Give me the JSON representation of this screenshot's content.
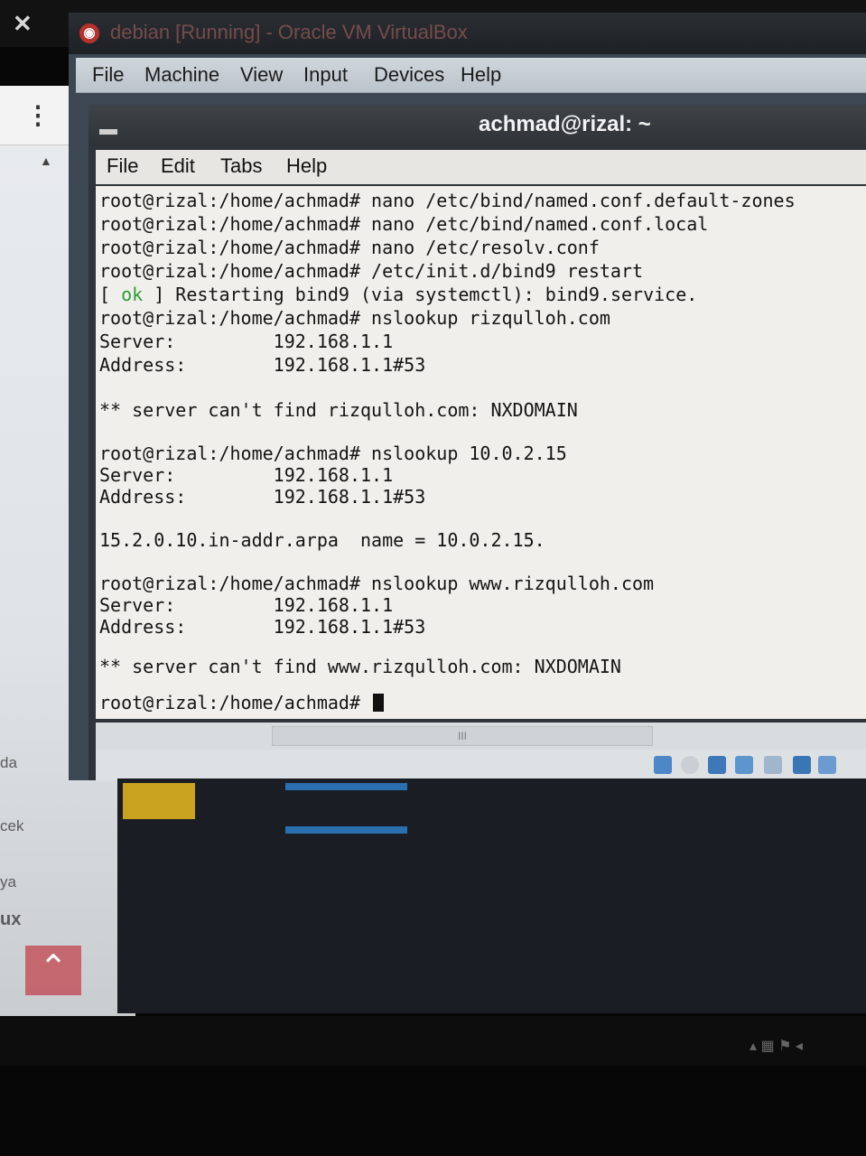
{
  "host": {
    "close_glyph": "✕",
    "kebab_glyph": "⋮",
    "side_words": [
      "da",
      "cek",
      "ya",
      "ux"
    ],
    "up_button_glyph": "⌃"
  },
  "vbox": {
    "title": "debian [Running] - Oracle VM VirtualBox",
    "menu": [
      "File",
      "Machine",
      "View",
      "Input",
      "Devices",
      "Help"
    ]
  },
  "terminal": {
    "title": "achmad@rizal: ~",
    "menu": [
      "File",
      "Edit",
      "Tabs",
      "Help"
    ],
    "lines": [
      "root@rizal:/home/achmad# nano /etc/bind/named.conf.default-zones",
      "root@rizal:/home/achmad# nano /etc/bind/named.conf.local",
      "root@rizal:/home/achmad# nano /etc/resolv.conf",
      "root@rizal:/home/achmad# /etc/init.d/bind9 restart",
      "[ ok ] Restarting bind9 (via systemctl): bind9.service.",
      "root@rizal:/home/achmad# nslookup rizqulloh.com",
      "Server:         192.168.1.1",
      "Address:        192.168.1.1#53",
      "",
      "** server can't find rizqulloh.com: NXDOMAIN",
      "",
      "root@rizal:/home/achmad# nslookup 10.0.2.15",
      "Server:         192.168.1.1",
      "Address:        192.168.1.1#53",
      "",
      "15.2.0.10.in-addr.arpa  name = 10.0.2.15.",
      "",
      "root@rizal:/home/achmad# nslookup www.rizqulloh.com",
      "Server:         192.168.1.1",
      "Address:        192.168.1.1#53",
      "",
      "** server can't find www.rizqulloh.com: NXDOMAIN",
      "",
      "root@rizal:/home/achmad# "
    ],
    "scroll_thumb_glyph": "III"
  },
  "colors": {
    "terminal_bg": "#f1efeb",
    "ok_green": "#2f9a39",
    "vbox_menubar": "#c6cdd3"
  }
}
